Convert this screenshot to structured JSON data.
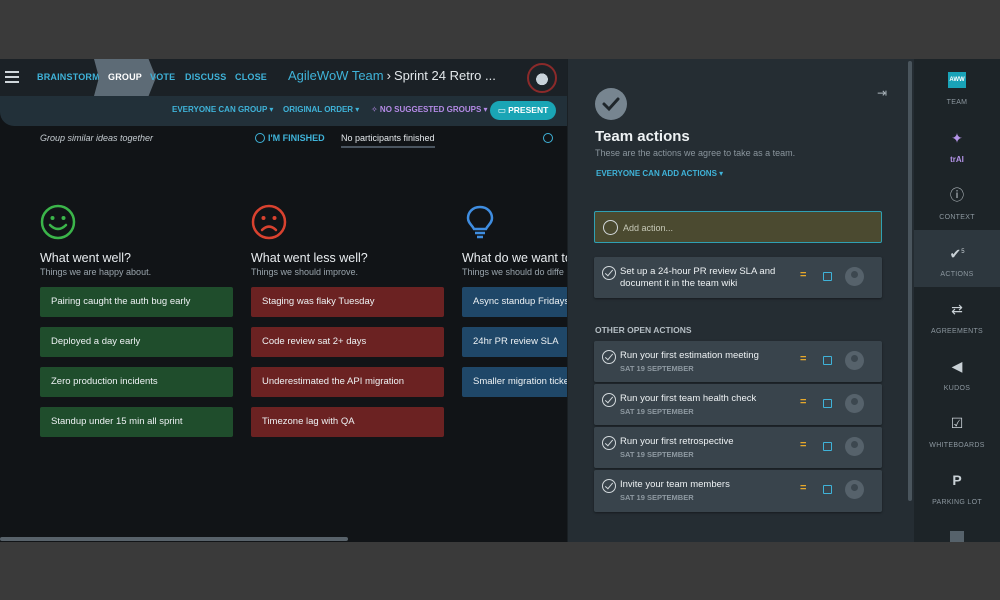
{
  "nav": {
    "steps": [
      "BRAINSTORM",
      "GROUP",
      "VOTE",
      "DISCUSS",
      "CLOSE"
    ],
    "active_step": "GROUP",
    "team": "AgileWoW Team",
    "separator": "›",
    "sprint": "Sprint 24 Retro ..."
  },
  "subbar": {
    "grouping": "EVERYONE CAN GROUP ▾",
    "order": "ORIGINAL ORDER ▾",
    "suggested": "✧ NO SUGGESTED GROUPS ▾",
    "present": "PRESENT"
  },
  "status": {
    "hint": "Group similar ideas together",
    "finished": "I'M FINISHED",
    "participants": "No participants finished"
  },
  "columns": [
    {
      "title": "What went well?",
      "subtitle": "Things we are happy about.",
      "cards": [
        "Pairing caught the auth bug early",
        "Deployed a day early",
        "Zero production incidents",
        "Standup under 15 min all sprint"
      ]
    },
    {
      "title": "What went less well?",
      "subtitle": "Things we should improve.",
      "cards": [
        "Staging was flaky Tuesday",
        "Code review sat 2+ days",
        "Underestimated the API migration",
        "Timezone lag with QA"
      ]
    },
    {
      "title": "What do we want to",
      "subtitle": "Things we should do diffe",
      "cards": [
        "Async standup Fridays",
        "24hr PR review SLA",
        "Smaller migration ticke"
      ]
    }
  ],
  "panel": {
    "title": "Team actions",
    "subtitle": "These are the actions we agree to take as a team.",
    "permission": "EVERYONE CAN ADD ACTIONS ▾",
    "add_placeholder": "Add action...",
    "team_actions": [
      {
        "text": "Set up a 24-hour PR review SLA and document it in the team wiki"
      }
    ],
    "other_label": "OTHER OPEN ACTIONS",
    "other_actions": [
      {
        "text": "Run your first estimation meeting",
        "date": "SAT 19 SEPTEMBER"
      },
      {
        "text": "Run your first team health check",
        "date": "SAT 19 SEPTEMBER"
      },
      {
        "text": "Run your first retrospective",
        "date": "SAT 19 SEPTEMBER"
      },
      {
        "text": "Invite your team members",
        "date": "SAT 19 SEPTEMBER"
      }
    ]
  },
  "sidebar": {
    "logo": "AWW",
    "items": [
      "TEAM",
      "trAI",
      "CONTEXT",
      "ACTIONS",
      "AGREEMENTS",
      "KUDOS",
      "WHITEBOARDS",
      "PARKING LOT"
    ],
    "actions_badge": "5"
  },
  "colors": {
    "accent": "#3fb3d9",
    "well": "#1f4d2c",
    "less": "#6b2222",
    "want": "#1f4768",
    "present": "#1aa5b5"
  }
}
